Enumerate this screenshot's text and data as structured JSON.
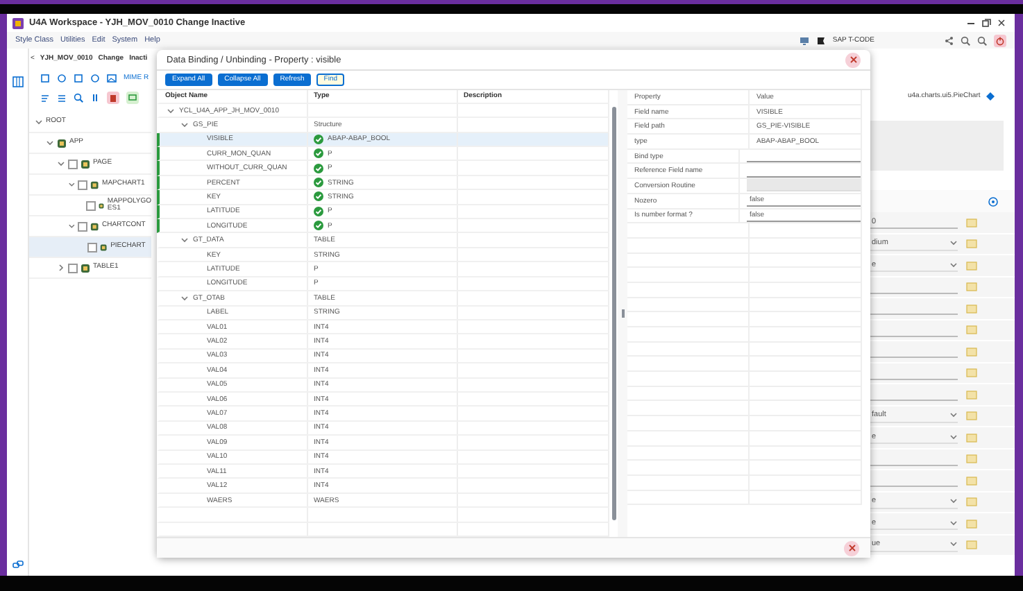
{
  "window": {
    "title": "U4A Workspace - YJH_MOV_0010 Change Inactive"
  },
  "menu": [
    "Style Class",
    "Utilities",
    "Edit",
    "System",
    "Help"
  ],
  "tcode": {
    "label": "SAP T-CODE"
  },
  "breadcrumb": {
    "back": "<",
    "app": "YJH_MOV_0010",
    "mode": "Change",
    "status": "Inacti"
  },
  "toolbar": {
    "mime_label": "MIME R"
  },
  "tree": [
    {
      "label": "ROOT",
      "expanded": true,
      "selected": false,
      "children": [
        {
          "label": "APP",
          "expanded": true,
          "selected": false,
          "children": [
            {
              "label": "PAGE",
              "expanded": true,
              "selected": false,
              "children": [
                {
                  "label": "MAPCHART1",
                  "expanded": true,
                  "selected": false,
                  "children": [
                    {
                      "label": "MAPPOLYGO ES1",
                      "selected": false
                    }
                  ]
                },
                {
                  "label": "CHARTCONT",
                  "expanded": true,
                  "selected": false,
                  "children": [
                    {
                      "label": "PIECHART",
                      "selected": true
                    }
                  ]
                }
              ]
            },
            {
              "label": "TABLE1",
              "expanded": false,
              "selected": false
            }
          ]
        }
      ]
    }
  ],
  "editor": {
    "class_name": "u4a.charts.ui5.PieChart",
    "fields": [
      {
        "kind": "input",
        "value": "0"
      },
      {
        "kind": "dropdown",
        "value": "dium"
      },
      {
        "kind": "dropdown",
        "value": "e"
      },
      {
        "kind": "input"
      },
      {
        "kind": "input"
      },
      {
        "kind": "input"
      },
      {
        "kind": "input"
      },
      {
        "kind": "input"
      },
      {
        "kind": "input"
      },
      {
        "kind": "dropdown",
        "value": "fault"
      },
      {
        "kind": "dropdown",
        "value": "e"
      },
      {
        "kind": "input"
      },
      {
        "kind": "input"
      },
      {
        "kind": "dropdown",
        "value": "e"
      },
      {
        "kind": "dropdown",
        "value": "e"
      },
      {
        "kind": "dropdown",
        "value": "ue"
      }
    ]
  },
  "dialog": {
    "title": "Data Binding / Unbinding - Property : visible",
    "buttons": [
      {
        "label": "Expand All",
        "kind": "primary"
      },
      {
        "label": "Collapse All",
        "kind": "primary"
      },
      {
        "label": "Refresh",
        "kind": "primary"
      },
      {
        "label": "Find",
        "kind": "outline"
      }
    ],
    "columns": [
      "Object Name",
      "Type",
      "Description"
    ],
    "rows": [
      {
        "name": "YCL_U4A_APP_JH_MOV_0010",
        "expanded": true,
        "selected": false,
        "children": [
          {
            "name": "GS_PIE",
            "type": "Structure",
            "expanded": true,
            "selected": false,
            "children": [
              {
                "name": "VISIBLE",
                "type": "ABAP-ABAP_BOOL",
                "bindable": true,
                "selected": true
              },
              {
                "name": "CURR_MON_QUAN",
                "type": "P",
                "bindable": true,
                "selected": false
              },
              {
                "name": "WITHOUT_CURR_QUAN",
                "type": "P",
                "bindable": true,
                "selected": false
              },
              {
                "name": "PERCENT",
                "type": "STRING",
                "bindable": true,
                "selected": false
              },
              {
                "name": "KEY",
                "type": "STRING",
                "bindable": true,
                "selected": false
              },
              {
                "name": "LATITUDE",
                "type": "P",
                "bindable": true,
                "selected": false
              },
              {
                "name": "LONGITUDE",
                "type": "P",
                "bindable": true,
                "selected": false
              }
            ]
          },
          {
            "name": "GT_DATA",
            "type": "TABLE",
            "expanded": true,
            "selected": false,
            "children": [
              {
                "name": "KEY",
                "type": "STRING",
                "bindable": false,
                "selected": false
              },
              {
                "name": "LATITUDE",
                "type": "P",
                "bindable": false,
                "selected": false
              },
              {
                "name": "LONGITUDE",
                "type": "P",
                "bindable": false,
                "selected": false
              }
            ]
          },
          {
            "name": "GT_OTAB",
            "type": "TABLE",
            "expanded": true,
            "selected": false,
            "children": [
              {
                "name": "LABEL",
                "type": "STRING",
                "bindable": false,
                "selected": false
              },
              {
                "name": "VAL01",
                "type": "INT4",
                "bindable": false,
                "selected": false
              },
              {
                "name": "VAL02",
                "type": "INT4",
                "bindable": false,
                "selected": false
              },
              {
                "name": "VAL03",
                "type": "INT4",
                "bindable": false,
                "selected": false
              },
              {
                "name": "VAL04",
                "type": "INT4",
                "bindable": false,
                "selected": false
              },
              {
                "name": "VAL05",
                "type": "INT4",
                "bindable": false,
                "selected": false
              },
              {
                "name": "VAL06",
                "type": "INT4",
                "bindable": false,
                "selected": false
              },
              {
                "name": "VAL07",
                "type": "INT4",
                "bindable": false,
                "selected": false
              },
              {
                "name": "VAL08",
                "type": "INT4",
                "bindable": false,
                "selected": false
              },
              {
                "name": "VAL09",
                "type": "INT4",
                "bindable": false,
                "selected": false
              },
              {
                "name": "VAL10",
                "type": "INT4",
                "bindable": false,
                "selected": false
              },
              {
                "name": "VAL11",
                "type": "INT4",
                "bindable": false,
                "selected": false
              },
              {
                "name": "VAL12",
                "type": "INT4",
                "bindable": false,
                "selected": false
              },
              {
                "name": "WAERS",
                "type": "WAERS",
                "bindable": false,
                "selected": false
              }
            ]
          }
        ]
      }
    ],
    "property_columns": [
      "Property",
      "Value"
    ],
    "properties": [
      {
        "label": "Field name",
        "kind": "text",
        "value": "VISIBLE"
      },
      {
        "label": "Field path",
        "kind": "text",
        "value": "GS_PIE-VISIBLE"
      },
      {
        "label": "type",
        "kind": "text",
        "value": "ABAP-ABAP_BOOL"
      },
      {
        "label": "Bind type",
        "kind": "input",
        "disabled": false
      },
      {
        "label": "Reference Field name",
        "kind": "input",
        "disabled": false
      },
      {
        "label": "Conversion Routine",
        "kind": "input",
        "disabled": true
      },
      {
        "label": "Nozero",
        "kind": "input",
        "value": "false",
        "disabled": false
      },
      {
        "label": "Is number format ?",
        "kind": "input",
        "value": "false",
        "disabled": false
      }
    ]
  }
}
